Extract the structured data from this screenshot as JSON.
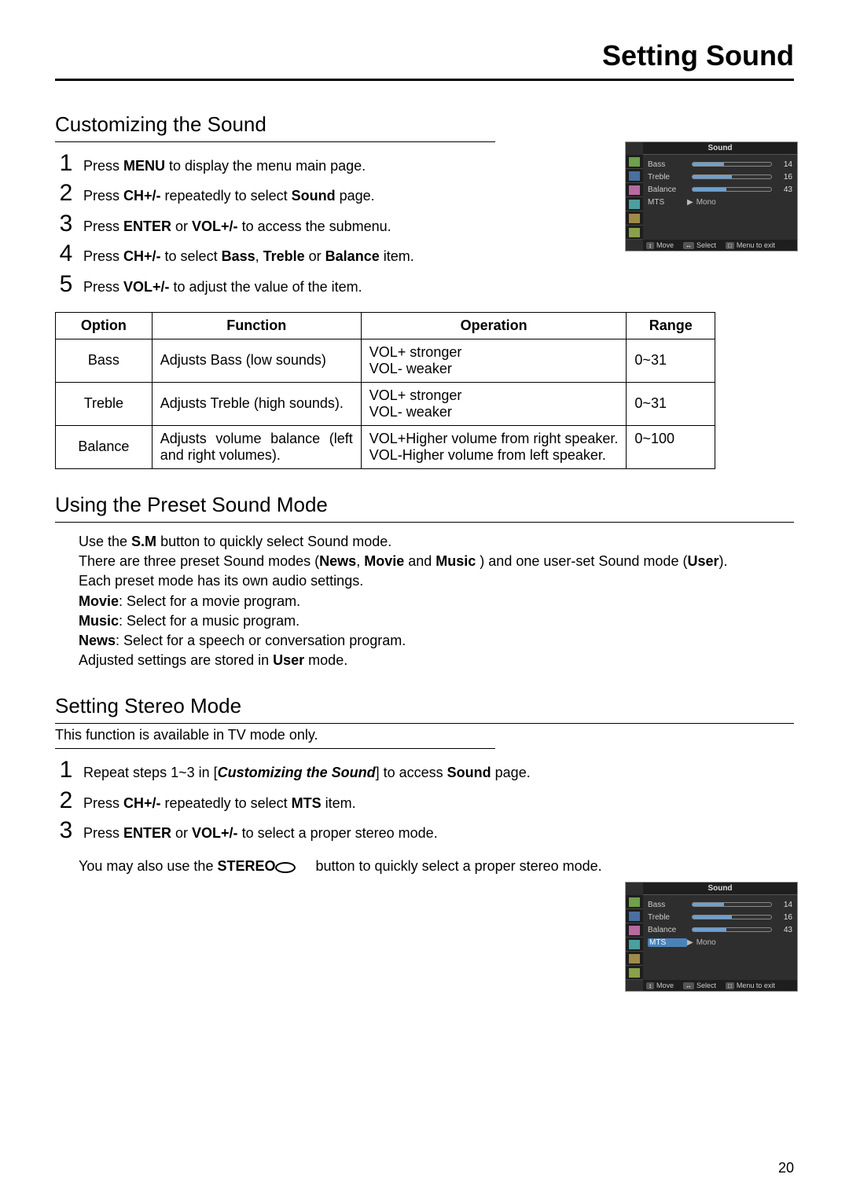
{
  "page_title": "Setting Sound",
  "page_number": "20",
  "section1": {
    "heading": "Customizing the Sound",
    "steps": [
      {
        "num": "1",
        "pre": "Press ",
        "b1": "MENU",
        "post": " to display the menu main page."
      },
      {
        "num": "2",
        "pre": "Press ",
        "b1": "CH+/-",
        "mid": " repeatedly to select ",
        "b2": "Sound",
        "post": " page."
      },
      {
        "num": "3",
        "pre": "Press ",
        "b1": "ENTER",
        "mid": " or ",
        "b2": "VOL+/-",
        "post": " to access the submenu."
      },
      {
        "num": "4",
        "pre": "Press ",
        "b1": "CH+/-",
        "mid": " to select ",
        "b2": "Bass",
        "mid2": ", ",
        "b3": "Treble",
        "mid3": " or ",
        "b4": "Balance",
        "post": " item."
      },
      {
        "num": "5",
        "pre": "Press ",
        "b1": "VOL+/-",
        "post": " to adjust the value of the item."
      }
    ]
  },
  "table": {
    "headers": {
      "option": "Option",
      "function": "Function",
      "operation": "Operation",
      "range": "Range"
    },
    "rows": [
      {
        "option": "Bass",
        "function": "Adjusts Bass (low sounds)",
        "operation": "VOL+  stronger\nVOL-  weaker",
        "range": "0~31"
      },
      {
        "option": "Treble",
        "function": "Adjusts Treble (high sounds).",
        "operation": "VOL+  stronger\nVOL-  weaker",
        "range": "0~31"
      },
      {
        "option": "Balance",
        "function": "Adjusts volume balance (left and right volumes).",
        "operation": "VOL+Higher volume from right speaker.\nVOL-Higher volume from left speaker.",
        "range": "0~100"
      }
    ]
  },
  "section2": {
    "heading": "Using the Preset Sound Mode",
    "line1": {
      "pre": "Use the ",
      "b": "S.M",
      "post": " button to quickly select Sound mode."
    },
    "line2": {
      "pre": "There are three preset Sound modes (",
      "b1": "News",
      "m1": ", ",
      "b2": "Movie",
      "m2": " and ",
      "b3": "Music",
      "m3": " ) and one user-set Sound mode (",
      "b4": "User",
      "post": ")."
    },
    "line3": "Each preset mode has its own audio  settings.",
    "line4": {
      "b": "Movie",
      "post": ": Select for a movie program."
    },
    "line5": {
      "b": "Music",
      "post": ": Select for a music program."
    },
    "line6": {
      "b": "News",
      "post": ": Select for a speech or conversation program."
    },
    "line7": {
      "pre": "Adjusted settings are stored in ",
      "b": "User",
      "post": " mode."
    }
  },
  "section3": {
    "heading": "Setting Stereo Mode",
    "sub": "This function is available in TV mode only.",
    "steps": [
      {
        "num": "1",
        "pre": "Repeat steps 1~3 in [",
        "bi": "Customizing the Sound",
        "mid": "] to access ",
        "b": "Sound",
        "post": " page."
      },
      {
        "num": "2",
        "pre": "Press ",
        "b1": "CH+/-",
        "mid": " repeatedly to select ",
        "b2": "MTS",
        "post": " item."
      },
      {
        "num": "3",
        "pre": "Press ",
        "b1": "ENTER",
        "mid": " or ",
        "b2": "VOL+/-",
        "post": " to select a proper stereo mode."
      }
    ],
    "note": {
      "pre": "You may also use the ",
      "b": "STEREO",
      "post": " button to quickly select a proper stereo mode."
    }
  },
  "osd": {
    "title": "Sound",
    "rows": [
      {
        "label": "Bass",
        "value": "14",
        "slider": true
      },
      {
        "label": "Treble",
        "value": "16",
        "slider": true
      },
      {
        "label": "Balance",
        "value": "43",
        "slider": true
      },
      {
        "label": "MTS",
        "value": "Mono",
        "slider": false
      }
    ],
    "footer": {
      "move": "Move",
      "select": "Select",
      "exit": "Menu to exit"
    }
  }
}
